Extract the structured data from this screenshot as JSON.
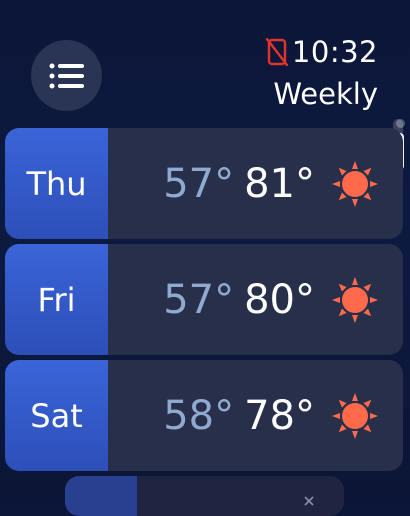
{
  "header": {
    "menu_icon": "list-icon",
    "status_icon": "phone-disconnected-icon",
    "time": "10:32",
    "title": "Weekly"
  },
  "colors": {
    "day_label_bg": "#3a64d8",
    "card_bg": "#272f4b",
    "low_temp": "#8fa9cf",
    "sun": "#ff6b4a",
    "status_icon": "#e0352b"
  },
  "days": [
    {
      "day": "Thu",
      "low": "57°",
      "high": "81°",
      "icon": "sun-icon"
    },
    {
      "day": "Fri",
      "low": "57°",
      "high": "80°",
      "icon": "sun-icon"
    },
    {
      "day": "Sat",
      "low": "58°",
      "high": "78°",
      "icon": "sun-icon"
    }
  ]
}
